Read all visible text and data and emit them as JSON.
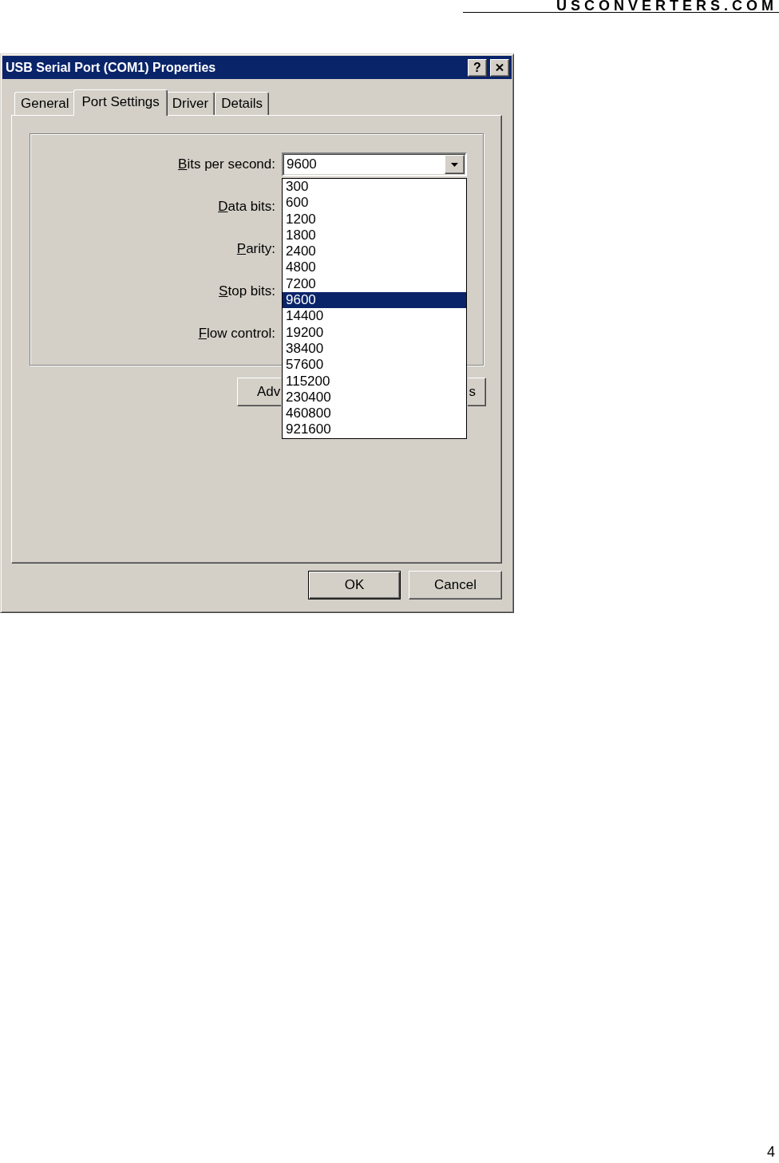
{
  "header": {
    "logo": "USCONVERTERS.COM"
  },
  "window": {
    "title": "USB Serial Port (COM1) Properties",
    "help_button": "?"
  },
  "tabs": [
    {
      "label": "General",
      "selected": false
    },
    {
      "label": "Port Settings",
      "selected": true
    },
    {
      "label": "Driver",
      "selected": false
    },
    {
      "label": "Details",
      "selected": false
    }
  ],
  "fields": [
    {
      "label": "Bits per second:",
      "value": "9600",
      "expanded": true,
      "options": [
        {
          "text": "300",
          "selected": false
        },
        {
          "text": "600",
          "selected": false
        },
        {
          "text": "1200",
          "selected": false
        },
        {
          "text": "1800",
          "selected": false
        },
        {
          "text": "2400",
          "selected": false
        },
        {
          "text": "4800",
          "selected": false
        },
        {
          "text": "7200",
          "selected": false
        },
        {
          "text": "9600",
          "selected": true
        },
        {
          "text": "14400",
          "selected": false
        },
        {
          "text": "19200",
          "selected": false
        },
        {
          "text": "38400",
          "selected": false
        },
        {
          "text": "57600",
          "selected": false
        },
        {
          "text": "115200",
          "selected": false
        },
        {
          "text": "230400",
          "selected": false
        },
        {
          "text": "460800",
          "selected": false
        },
        {
          "text": "921600",
          "selected": false
        }
      ]
    },
    {
      "label": "Data bits:"
    },
    {
      "label": "Parity:"
    },
    {
      "label": "Stop bits:"
    },
    {
      "label": "Flow control:"
    }
  ],
  "panel_buttons": [
    {
      "label": "Adv"
    },
    {
      "label": "s"
    }
  ],
  "buttons": [
    {
      "label": "OK",
      "default": true
    },
    {
      "label": "Cancel",
      "default": false
    }
  ],
  "page_number": "4"
}
